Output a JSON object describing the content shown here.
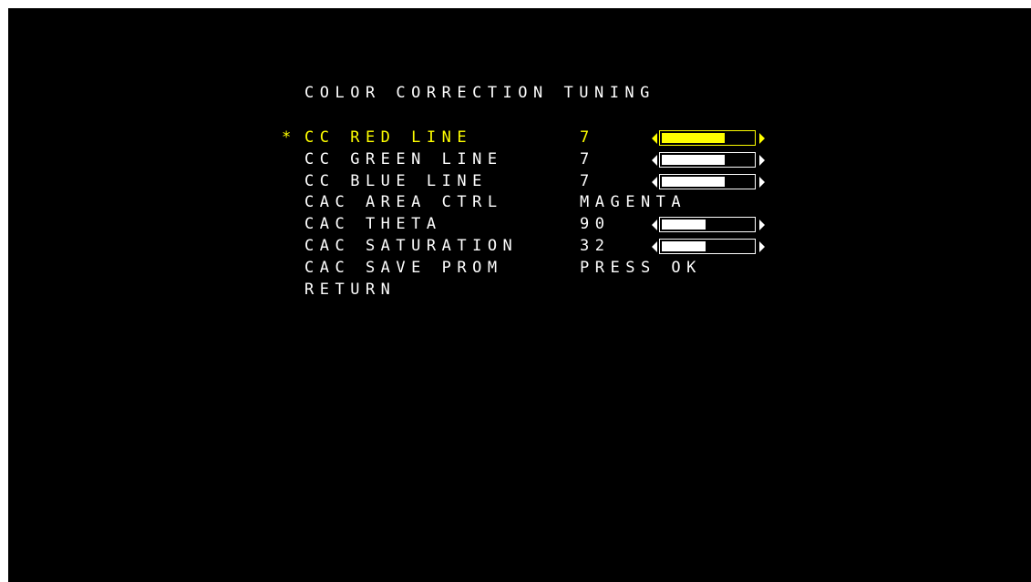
{
  "osd": {
    "title": "COLOR CORRECTION TUNING",
    "text_color": "#ffffff",
    "selected_color": "#ffff00",
    "background": "#000000",
    "items": [
      {
        "cursor": "*",
        "label": "CC RED LINE",
        "value": "7",
        "slider": true,
        "level": 0.68,
        "selected": true
      },
      {
        "cursor": "",
        "label": "CC GREEN LINE",
        "value": "7",
        "slider": true,
        "level": 0.68,
        "selected": false
      },
      {
        "cursor": "",
        "label": "CC BLUE LINE",
        "value": "7",
        "slider": true,
        "level": 0.68,
        "selected": false
      },
      {
        "cursor": "",
        "label": "CAC AREA CTRL",
        "value": "MAGENTA",
        "slider": false,
        "selected": false
      },
      {
        "cursor": "",
        "label": "CAC THETA",
        "value": "90",
        "slider": true,
        "level": 0.47,
        "selected": false
      },
      {
        "cursor": "",
        "label": "CAC SATURATION",
        "value": "32",
        "slider": true,
        "level": 0.47,
        "selected": false
      },
      {
        "cursor": "",
        "label": "CAC SAVE PROM",
        "value": "PRESS OK",
        "slider": false,
        "selected": false
      },
      {
        "cursor": "",
        "label": "RETURN",
        "value": "",
        "slider": false,
        "selected": false
      }
    ]
  }
}
